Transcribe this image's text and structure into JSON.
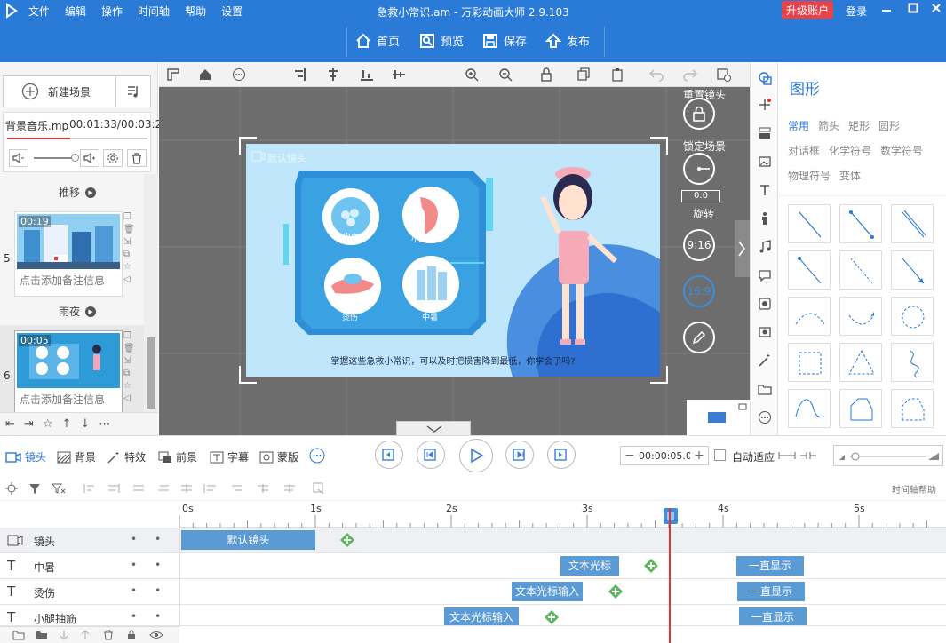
{
  "app": {
    "title": "急救小常识.am - 万彩动画大师 2.9.103",
    "menu": [
      "文件",
      "编辑",
      "操作",
      "时间轴",
      "帮助",
      "设置"
    ],
    "upgrade": "升级账户",
    "login": "登录",
    "window_controls": [
      "minimize-icon",
      "maximize-icon",
      "close-icon"
    ]
  },
  "toolbar": {
    "home": "首页",
    "preview": "预览",
    "save": "保存",
    "publish": "发布"
  },
  "left_panel": {
    "new_scene": "新建场景",
    "music": {
      "filename": "背景音乐.mp",
      "time": "00:01:33/00:03:26"
    },
    "scenes": [
      {
        "transition": "推移"
      },
      {
        "index": "5",
        "duration": "00:19",
        "note": "点击添加备注信息",
        "transition": "雨夜"
      },
      {
        "index": "6",
        "duration": "00:05",
        "note": "点击添加备注信息"
      }
    ]
  },
  "stage": {
    "camera_label": "默认镜头",
    "caption": "掌握这些急救小常识，可以及时把损害降到最低，你学会了吗?",
    "icons": [
      "鼻出血",
      "小腿抽筋",
      "烫伤",
      "中暑"
    ],
    "controls": {
      "reset_camera": "重置镜头",
      "lock_scene": "锁定场景",
      "rotation_value": "0.0",
      "rotate": "旋转",
      "ratio_9_16": "9:16",
      "ratio_16_9": "16:9"
    }
  },
  "shapes_panel": {
    "title": "图形",
    "categories": [
      "常用",
      "箭头",
      "矩形",
      "圆形",
      "对话框",
      "化学符号",
      "数学符号",
      "物理符号",
      "变体"
    ],
    "active_category": "常用"
  },
  "timeline": {
    "tabs": [
      "镜头",
      "背景",
      "特效",
      "前景",
      "字幕",
      "蒙版"
    ],
    "time_value": "00:00:05.0",
    "auto_fit": "自动适应",
    "help": "时间轴帮助",
    "ruler": [
      "0s",
      "1s",
      "2s",
      "3s",
      "4s",
      "5s"
    ],
    "rows": [
      {
        "name": "镜头",
        "blocks": [
          "默认镜头"
        ]
      },
      {
        "name": "中暑",
        "blocks": [
          "文本光标",
          "一直显示"
        ]
      },
      {
        "name": "烫伤",
        "blocks": [
          "文本光标输入",
          "一直显示"
        ]
      },
      {
        "name": "小腿抽筋",
        "blocks": [
          "文本光标输入",
          "一直显示"
        ]
      }
    ]
  },
  "colors": {
    "brand": "#2a7ad8",
    "upgrade": "#e8424b",
    "block": "#5b9bd5",
    "playhead": "#e3342f",
    "plus": "#5cb85c"
  }
}
